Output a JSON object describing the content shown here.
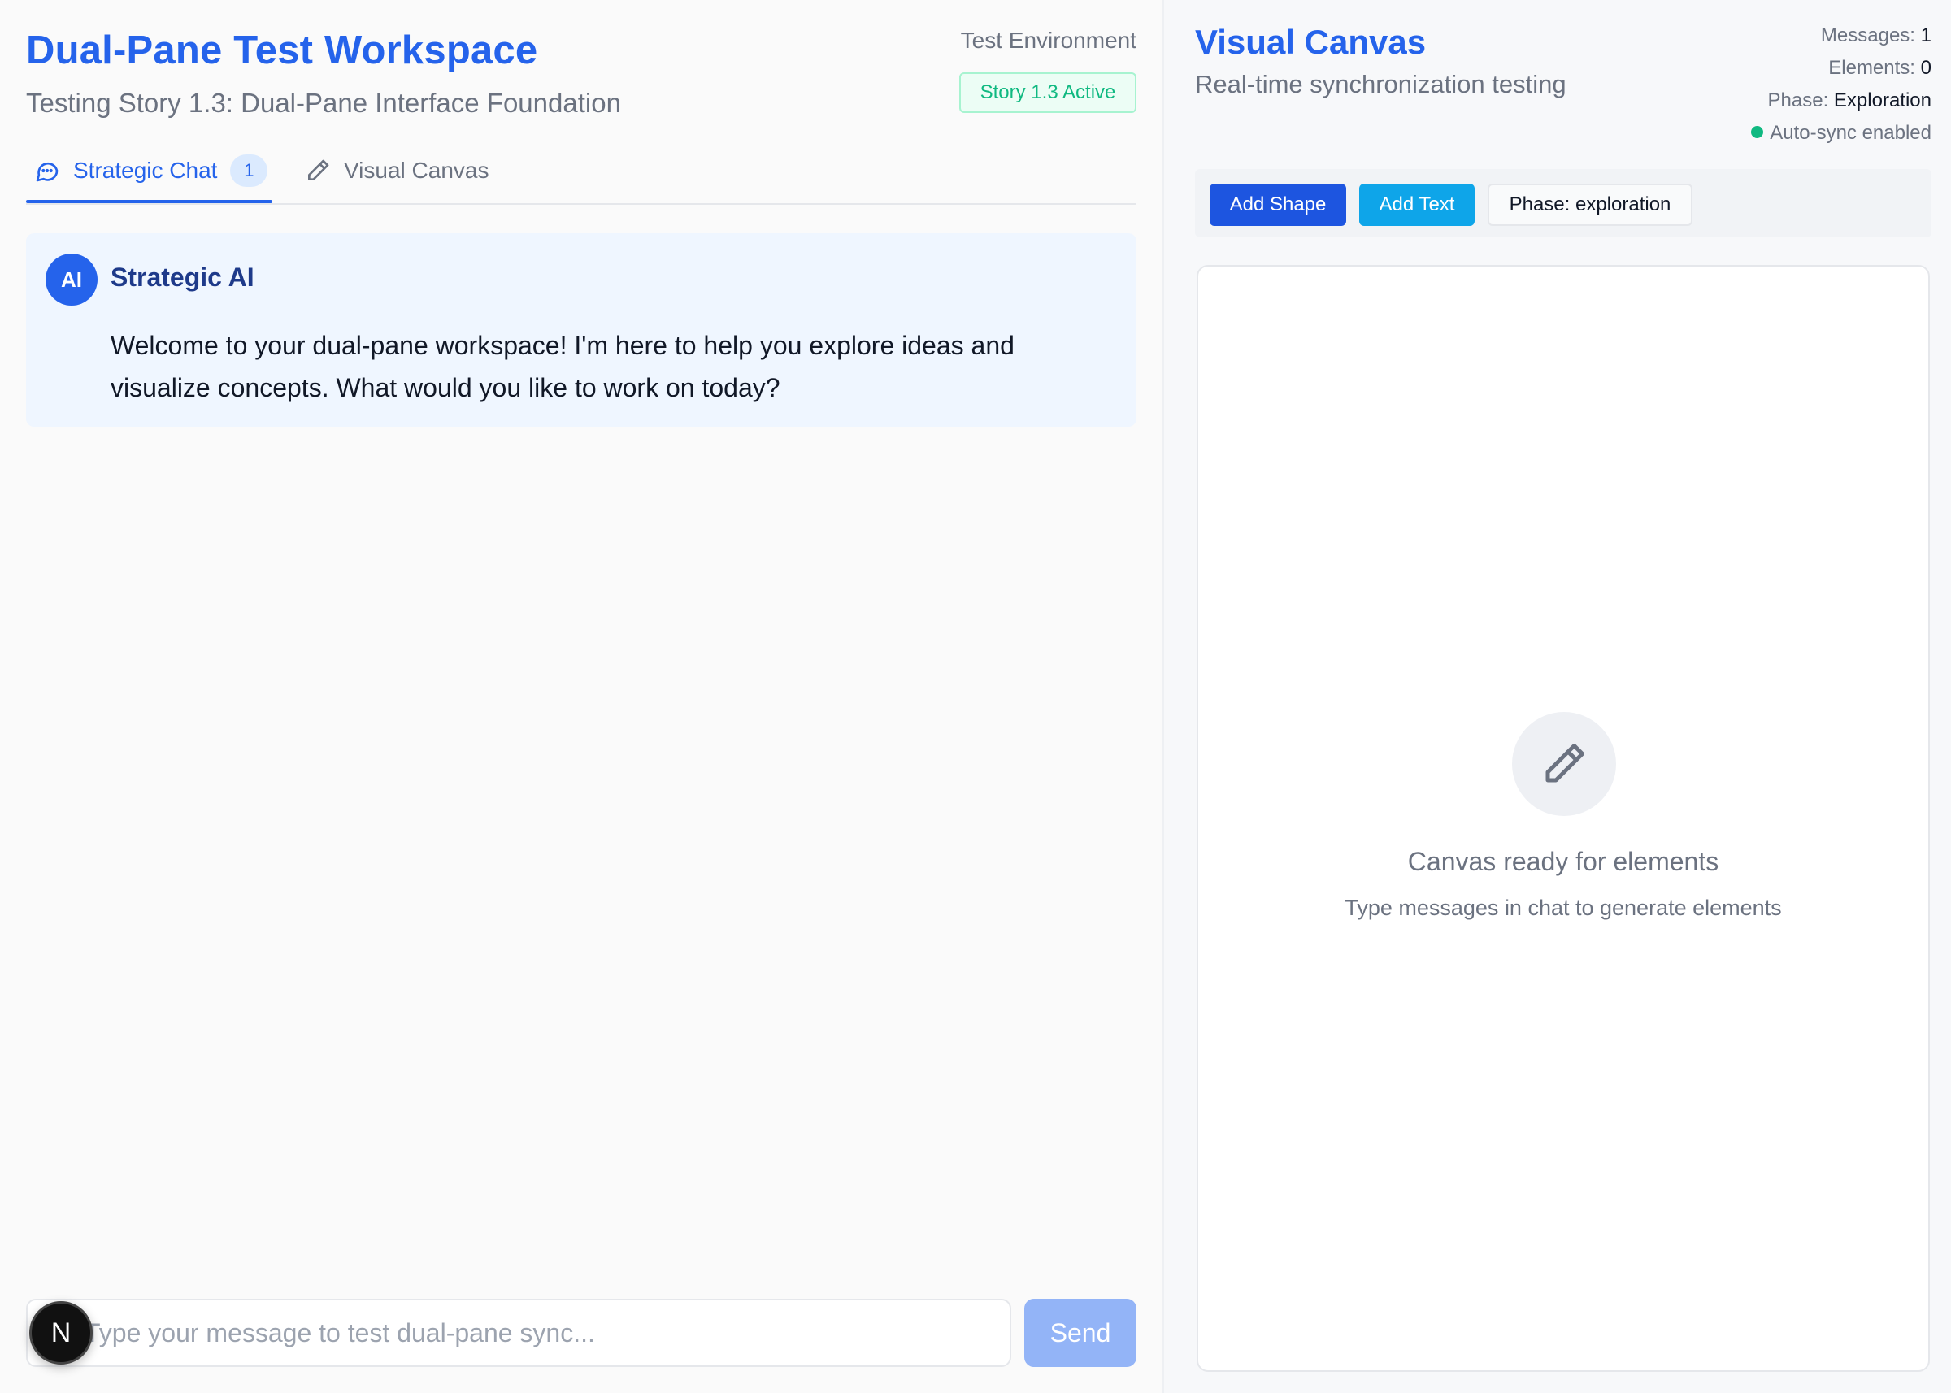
{
  "left_pane": {
    "title": "Dual-Pane Test Workspace",
    "subtitle": "Testing Story 1.3: Dual-Pane Interface Foundation",
    "environment_label": "Test Environment",
    "story_badge": "Story 1.3 Active",
    "tabs": [
      {
        "label": "Strategic Chat",
        "icon": "chat-bubble-icon",
        "count": "1",
        "active": true
      },
      {
        "label": "Visual Canvas",
        "icon": "pencil-icon",
        "active": false
      }
    ],
    "message": {
      "avatar": "AI",
      "sender": "Strategic AI",
      "text": "Welcome to your dual-pane workspace! I'm here to help you explore ideas and visualize concepts. What would you like to work on today?"
    },
    "input": {
      "value": "",
      "placeholder": "Type your message to test dual-pane sync..."
    },
    "send_label": "Send",
    "n_badge": "N"
  },
  "right_pane": {
    "title": "Visual Canvas",
    "subtitle": "Real-time synchronization testing",
    "stats": {
      "messages_label": "Messages:",
      "messages_value": "1",
      "elements_label": "Elements:",
      "elements_value": "0",
      "phase_label": "Phase:",
      "phase_value": "Exploration",
      "sync_status": "Auto-sync enabled"
    },
    "toolbar": {
      "add_shape": "Add Shape",
      "add_text": "Add Text",
      "phase_button": "Phase: exploration"
    },
    "canvas_empty": {
      "icon": "pencil-icon",
      "title": "Canvas ready for elements",
      "subtitle": "Type messages in chat to generate elements"
    }
  },
  "colors": {
    "accent": "#2563eb",
    "success": "#10b981",
    "info": "#0ea5e9",
    "muted": "#6b7280"
  }
}
